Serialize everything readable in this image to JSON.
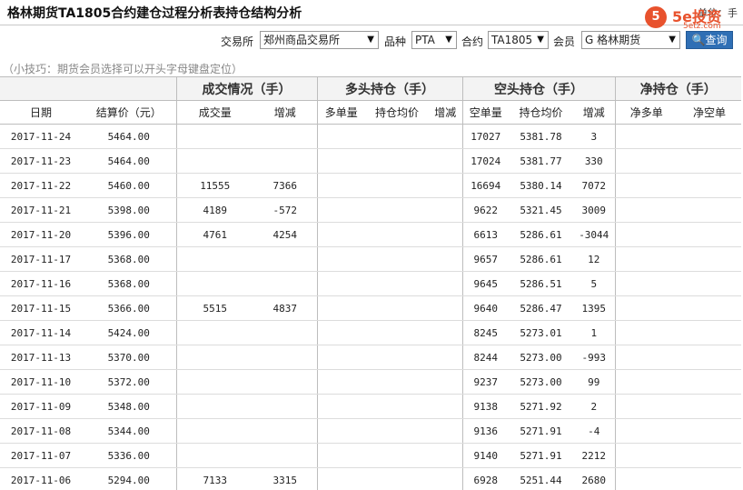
{
  "header": {
    "title": "格林期货TA1805合约建仓过程分析表持仓结构分析",
    "unit_label": "单位：手"
  },
  "logo": {
    "mark": "5",
    "name": "5e投资",
    "sub": "5etz.com"
  },
  "filters": {
    "exchange_label": "交易所",
    "exchange_value": "郑州商品交易所",
    "product_label": "品种",
    "product_value": "PTA",
    "contract_label": "合约",
    "contract_value": "TA1805",
    "member_label": "会员",
    "member_value": "G 格林期货",
    "query_label": "查询"
  },
  "tip": "（小技巧：期货会员选择可以开头字母键盘定位）",
  "table": {
    "groups": {
      "volume": "成交情况（手）",
      "long": "多头持仓（手）",
      "short": "空头持仓（手）",
      "net": "净持仓（手）"
    },
    "columns": {
      "date": "日期",
      "settle": "结算价（元）",
      "volume": "成交量",
      "volume_chg": "增减",
      "long_qty": "多单量",
      "long_avg": "持仓均价",
      "long_chg": "增减",
      "short_qty": "空单量",
      "short_avg": "持仓均价",
      "short_chg": "增减",
      "net_long": "净多单",
      "net_short": "净空单"
    },
    "rows": [
      {
        "date": "2017-11-24",
        "settle": "5464.00",
        "volume": "",
        "volume_chg": "",
        "short_qty": "17027",
        "short_avg": "5381.78",
        "short_chg": "3"
      },
      {
        "date": "2017-11-23",
        "settle": "5464.00",
        "volume": "",
        "volume_chg": "",
        "short_qty": "17024",
        "short_avg": "5381.77",
        "short_chg": "330"
      },
      {
        "date": "2017-11-22",
        "settle": "5460.00",
        "volume": "11555",
        "volume_chg": "7366",
        "short_qty": "16694",
        "short_avg": "5380.14",
        "short_chg": "7072"
      },
      {
        "date": "2017-11-21",
        "settle": "5398.00",
        "volume": "4189",
        "volume_chg": "-572",
        "short_qty": "9622",
        "short_avg": "5321.45",
        "short_chg": "3009"
      },
      {
        "date": "2017-11-20",
        "settle": "5396.00",
        "volume": "4761",
        "volume_chg": "4254",
        "short_qty": "6613",
        "short_avg": "5286.61",
        "short_chg": "-3044"
      },
      {
        "date": "2017-11-17",
        "settle": "5368.00",
        "volume": "",
        "volume_chg": "",
        "short_qty": "9657",
        "short_avg": "5286.61",
        "short_chg": "12"
      },
      {
        "date": "2017-11-16",
        "settle": "5368.00",
        "volume": "",
        "volume_chg": "",
        "short_qty": "9645",
        "short_avg": "5286.51",
        "short_chg": "5"
      },
      {
        "date": "2017-11-15",
        "settle": "5366.00",
        "volume": "5515",
        "volume_chg": "4837",
        "short_qty": "9640",
        "short_avg": "5286.47",
        "short_chg": "1395"
      },
      {
        "date": "2017-11-14",
        "settle": "5424.00",
        "volume": "",
        "volume_chg": "",
        "short_qty": "8245",
        "short_avg": "5273.01",
        "short_chg": "1"
      },
      {
        "date": "2017-11-13",
        "settle": "5370.00",
        "volume": "",
        "volume_chg": "",
        "short_qty": "8244",
        "short_avg": "5273.00",
        "short_chg": "-993"
      },
      {
        "date": "2017-11-10",
        "settle": "5372.00",
        "volume": "",
        "volume_chg": "",
        "short_qty": "9237",
        "short_avg": "5273.00",
        "short_chg": "99"
      },
      {
        "date": "2017-11-09",
        "settle": "5348.00",
        "volume": "",
        "volume_chg": "",
        "short_qty": "9138",
        "short_avg": "5271.92",
        "short_chg": "2"
      },
      {
        "date": "2017-11-08",
        "settle": "5344.00",
        "volume": "",
        "volume_chg": "",
        "short_qty": "9136",
        "short_avg": "5271.91",
        "short_chg": "-4"
      },
      {
        "date": "2017-11-07",
        "settle": "5336.00",
        "volume": "",
        "volume_chg": "",
        "short_qty": "9140",
        "short_avg": "5271.91",
        "short_chg": "2212"
      },
      {
        "date": "2017-11-06",
        "settle": "5294.00",
        "volume": "7133",
        "volume_chg": "3315",
        "short_qty": "6928",
        "short_avg": "5251.44",
        "short_chg": "2680"
      }
    ]
  },
  "colors": {
    "increase": "#d2201e",
    "decrease": "#1f9a1f",
    "button": "#2f6fb5",
    "logo": "#e8522d"
  }
}
